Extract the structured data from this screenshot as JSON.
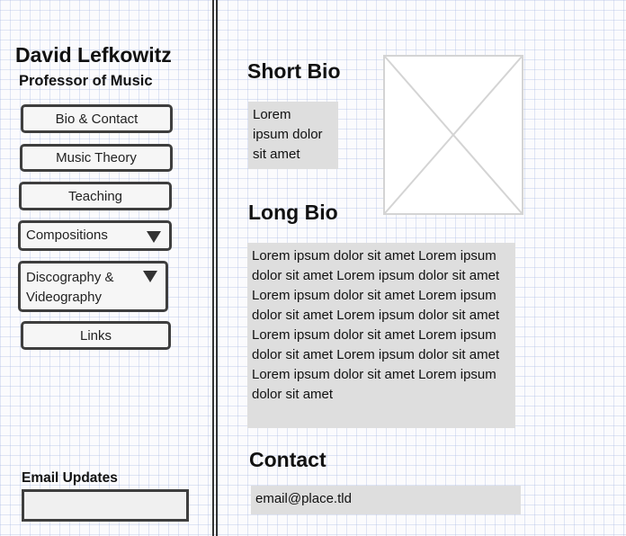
{
  "sidebar": {
    "name": "David Lefkowitz",
    "subtitle": "Professor of Music",
    "nav": {
      "bio_contact": "Bio & Contact",
      "music_theory": "Music Theory",
      "teaching": "Teaching",
      "compositions": "Compositions",
      "discography_line1": "Discography &",
      "discography_line2": "Videography",
      "links": "Links"
    },
    "email_updates_label": "Email Updates",
    "email_input_value": ""
  },
  "main": {
    "short_bio": {
      "heading": "Short Bio",
      "text": "Lorem ipsum dolor sit amet"
    },
    "long_bio": {
      "heading": "Long Bio",
      "text": "Lorem ipsum dolor sit amet Lorem ipsum dolor sit amet Lorem ipsum dolor sit amet Lorem ipsum dolor sit amet Lorem ipsum dolor sit amet Lorem ipsum dolor sit amet Lorem ipsum dolor sit amet Lorem ipsum dolor sit amet Lorem ipsum dolor sit amet Lorem ipsum dolor sit amet Lorem ipsum dolor sit amet"
    },
    "contact": {
      "heading": "Contact",
      "email": "email@place.tld"
    }
  },
  "icons": {
    "photo": "image-placeholder-icon",
    "dropdown": "triangle-down-icon"
  }
}
